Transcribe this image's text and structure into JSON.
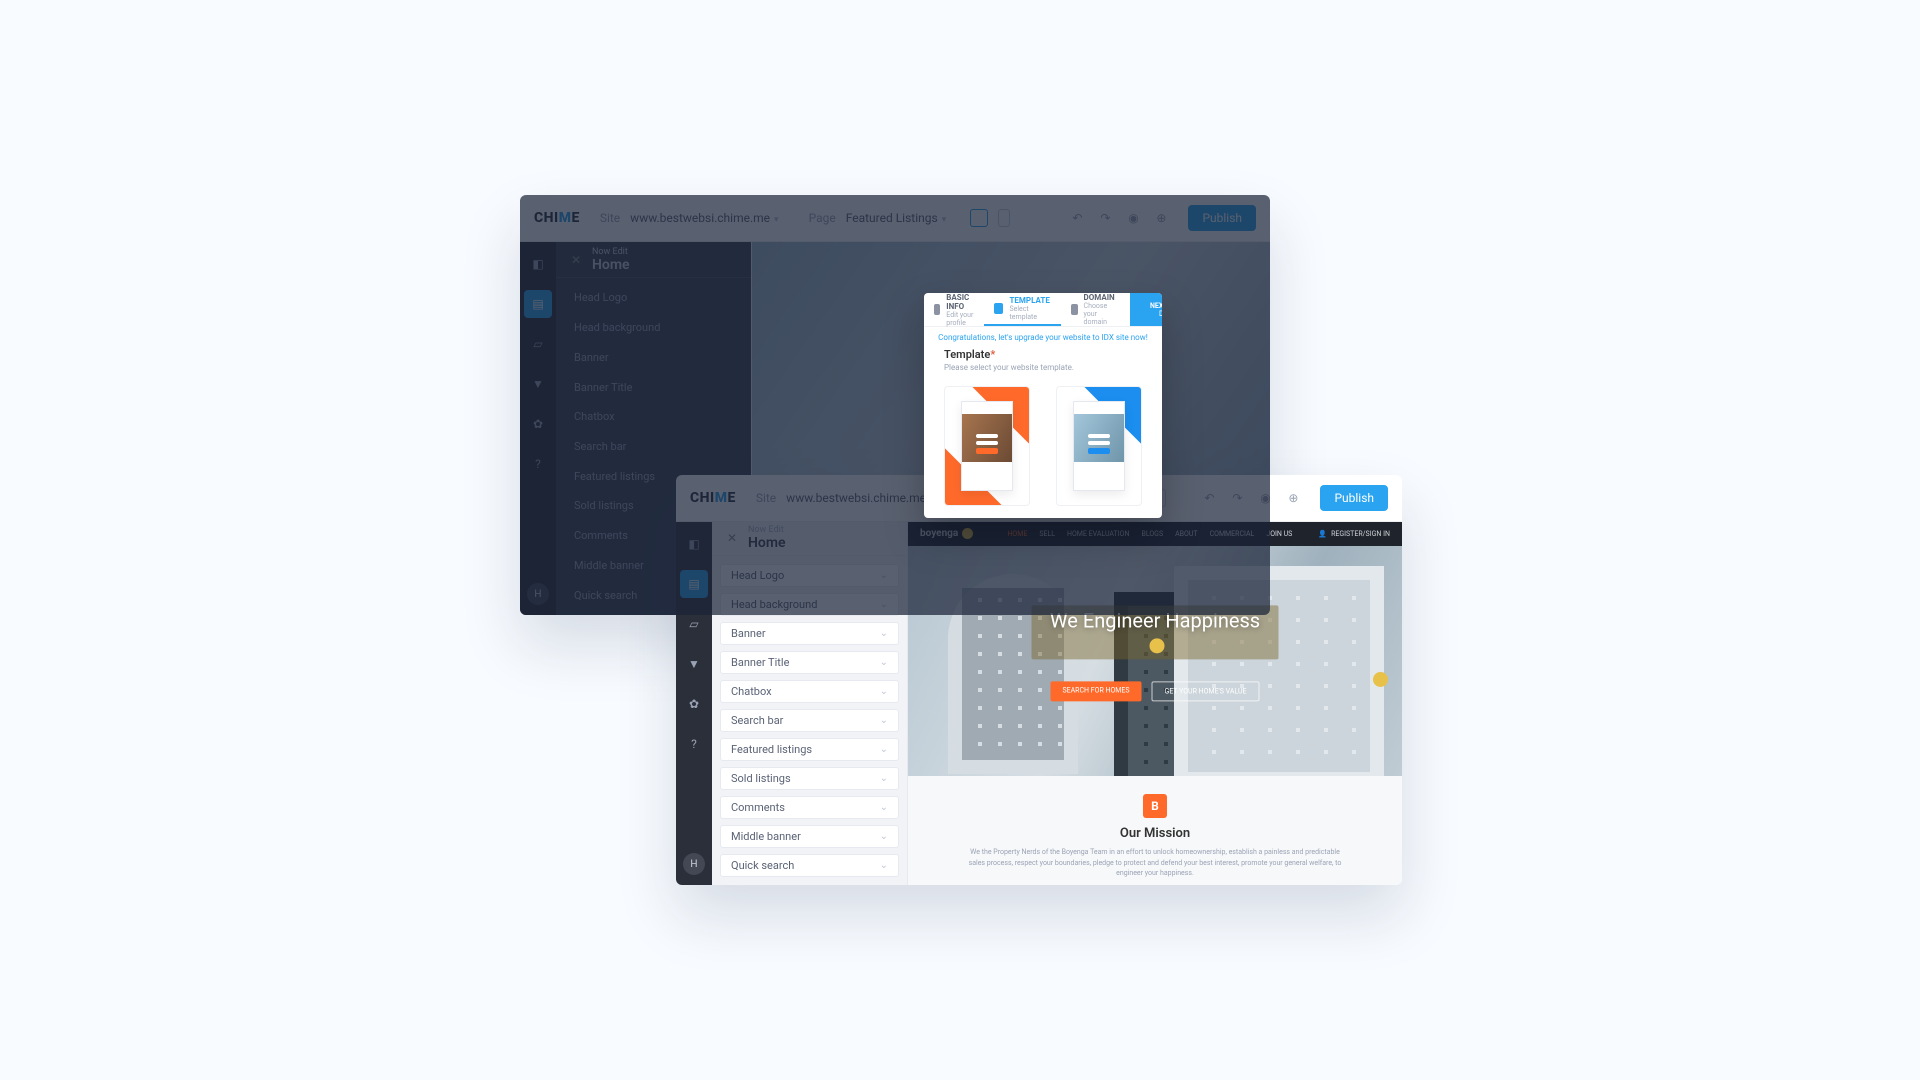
{
  "logo_text": "CHIME",
  "topbar": {
    "site_label": "Site",
    "site_value": "www.bestwebsi.chime.me",
    "page_label": "Page",
    "page_value": "Featured Listings",
    "publish": "Publish"
  },
  "side": {
    "sub": "Now Edit",
    "title": "Home",
    "items": [
      "Head Logo",
      "Head background",
      "Banner",
      "Banner Title",
      "Chatbox",
      "Search bar",
      "Featured listings",
      "Sold listings",
      "Comments",
      "Middle banner",
      "Quick search"
    ]
  },
  "rail_avatar": "H",
  "modal": {
    "tab1": {
      "title": "BASIC INFO",
      "sub": "Edit your profile"
    },
    "tab2": {
      "title": "TEMPLATE",
      "sub": "Select template"
    },
    "tab3": {
      "title": "DOMAIN",
      "sub": "Choose your domain"
    },
    "next_top": "NEXT STEP →",
    "next_bottom": "DOMAIN",
    "note": "Congratulations, let's upgrade your website to IDX site now!",
    "section": "Template",
    "hint": "Please select your website template."
  },
  "site": {
    "brand": "boyenga",
    "nav": [
      "HOME",
      "SELL",
      "HOME EVALUATION",
      "BLOGS",
      "ABOUT",
      "COMMERCIAL",
      "JOIN US"
    ],
    "nav_register": "REGISTER/SIGN IN",
    "tagline": "We Engineer Happiness",
    "btn_primary": "SEARCH FOR HOMES",
    "btn_ghost": "GET YOUR HOME'S VALUE",
    "mission_badge": "B",
    "mission_title": "Our Mission",
    "mission_body": "We the Property Nerds of the Boyenga Team in an effort to unlock homeownership, establish a painless and predictable sales process, respect your boundaries, pledge to protect and defend your best interest, promote your general welfare, to engineer your happiness."
  }
}
